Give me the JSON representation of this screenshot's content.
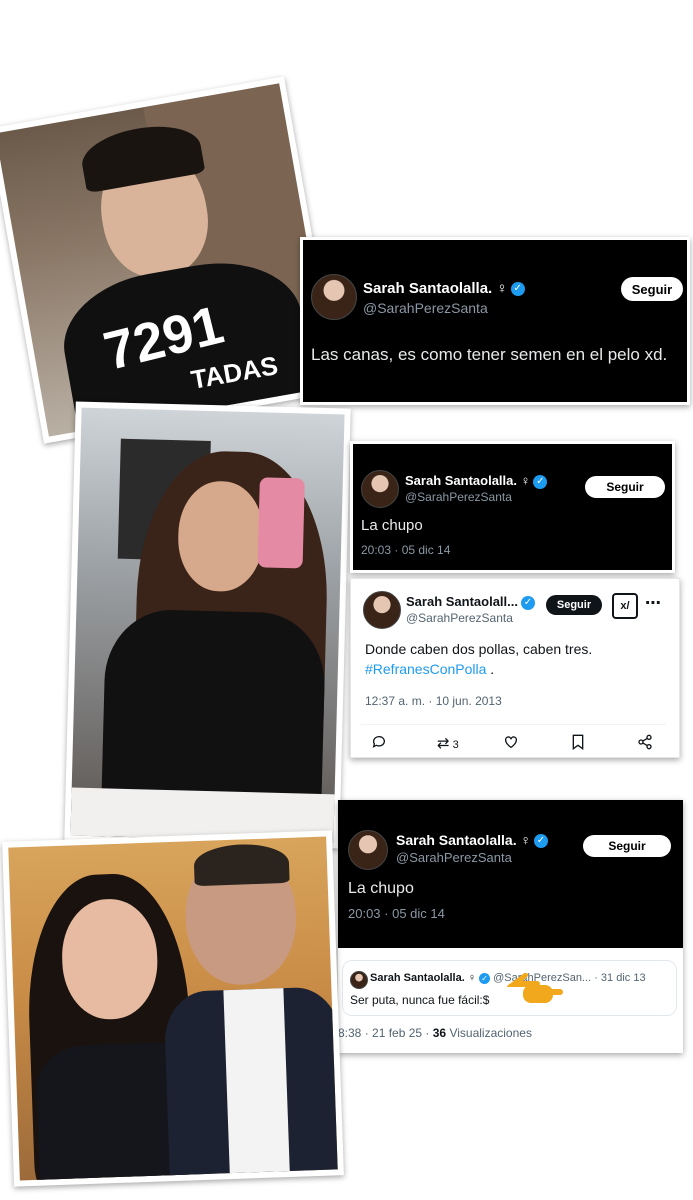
{
  "tweet1": {
    "name": "Sarah Santaolalla. ♀",
    "handle": "@SarahPerezSanta",
    "follow": "Seguir",
    "text": "Las canas, es como tener semen en el pelo xd."
  },
  "tweet2": {
    "name": "Sarah Santaolalla. ♀",
    "handle": "@SarahPerezSanta",
    "follow": "Seguir",
    "text": "La chupo",
    "time": "20:03 · 05 dic 14"
  },
  "tweet3": {
    "name": "Sarah Santaolall...",
    "handle": "@SarahPerezSanta",
    "follow": "Seguir",
    "text": "Donde caben dos pollas, caben tres.",
    "hashtag": "#RefranesConPolla",
    "dot": ".",
    "time": "12:37 a. m. · 10 jun. 2013",
    "retweets": "3",
    "grok_label": "x/"
  },
  "tweet4": {
    "name": "Sarah Santaolalla. ♀",
    "handle": "@SarahPerezSanta",
    "follow": "Seguir",
    "text": "La chupo",
    "time": "20:03 · 05 dic 14"
  },
  "tweet5": {
    "name": "Sarah Santaolalla. ♀",
    "handle": "@SarahPerezSan...",
    "date": "· 31 dic 13",
    "text": "Ser puta, nunca fue fácil:$",
    "footer_time": "8:38 · 21 feb 25 ·",
    "views_count": "36",
    "views_label": "Visualizaciones"
  },
  "photo1": {
    "shirt_number": "7291",
    "shirt_text": "TADAS"
  },
  "colors": {
    "accent": "#1d9bf0",
    "dark_bg": "#000000",
    "pointer": "#f2a81d"
  }
}
